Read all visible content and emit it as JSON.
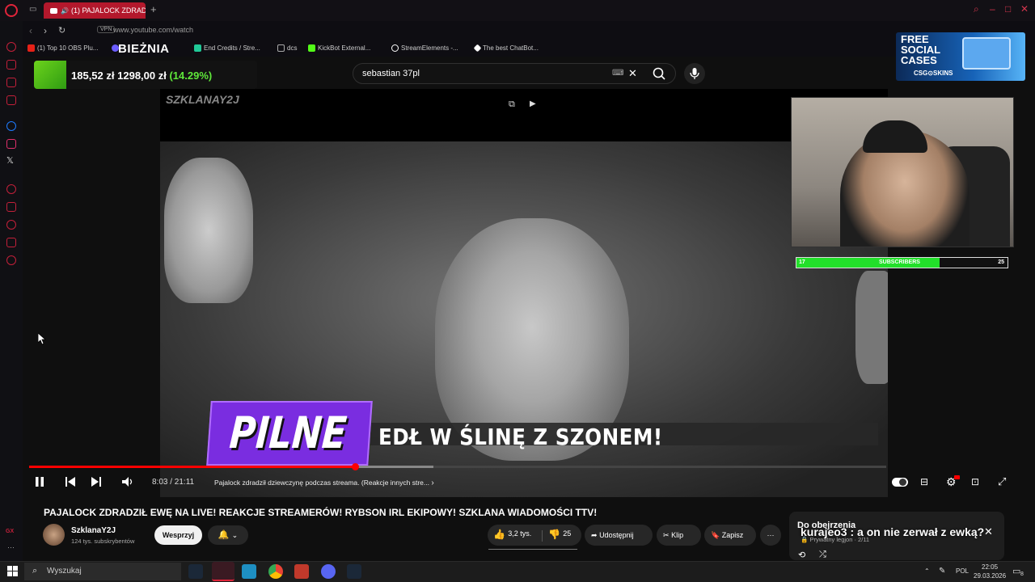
{
  "browser": {
    "tab_title": "(1) PAJALOCK ZDRADZ",
    "url": "www.youtube.com/watch",
    "vpn_label": "VPN",
    "bookmarks": [
      {
        "label": "(1) Top 10 OBS Plu...",
        "color": "#e62117"
      },
      {
        "label": "",
        "color": "#6b5cff"
      },
      {
        "label": "End Credits / Stre...",
        "color": "#20c997"
      },
      {
        "label": "dcs",
        "color": "#aaaaaa"
      },
      {
        "label": "KickBot External...",
        "color": "#53fc18"
      },
      {
        "label": "StreamElements -...",
        "color": "#ffffff"
      },
      {
        "label": "The best ChatBot...",
        "color": "#ffffff"
      }
    ]
  },
  "overlay": {
    "biezna": "BIEŻNIA",
    "stock_value1": "185,52 zł",
    "stock_value2": "1298,00 zł",
    "stock_pct": "(14.29%)",
    "ad_line1": "FREE",
    "ad_line2": "SOCIAL",
    "ad_line3": "CASES",
    "ad_brand": "CSG⊙SKINS",
    "sub_start": "17",
    "sub_label": "SUBSCRIBERS",
    "sub_end": "25",
    "sub_progress": 0.68,
    "watermark": "SZKLANAY2J",
    "pilne": "PILNE",
    "banner": "EDŁ W ŚLINĘ Z SZONEM!"
  },
  "search": {
    "value": "sebastian 37pl"
  },
  "player": {
    "time": "8:03 / 21:11",
    "progress": 0.38,
    "chapter": "Pajalock zdradził dziewczynę podczas streama. (Reakcje innych stre..."
  },
  "video": {
    "title": "PAJALOCK ZDRADZIŁ EWĘ NA LIVE! REAKCJE STREAMERÓW! RYBSON IRL EKIPOWY! SZKLANA WIADOMOŚCI TTV!",
    "channel": "SzklanaY2J",
    "subs": "124 tys. subskrybentów",
    "support": "Wesprzyj",
    "likes": "3,2 tys.",
    "dislikes": "25",
    "share": "Udostępnij",
    "clip": "Klip",
    "save": "Zapisz"
  },
  "upnext": {
    "title": "Do obejrzenia",
    "overlay_text": "kurajeo3 : a on nie zerwał z ewką?",
    "playlist": "Prywatny legjon · 2/11"
  },
  "taskbar": {
    "search_placeholder": "Wyszukaj",
    "lang": "POL",
    "time": "22:05",
    "date": "29.03.2026",
    "notif_count": "8"
  }
}
